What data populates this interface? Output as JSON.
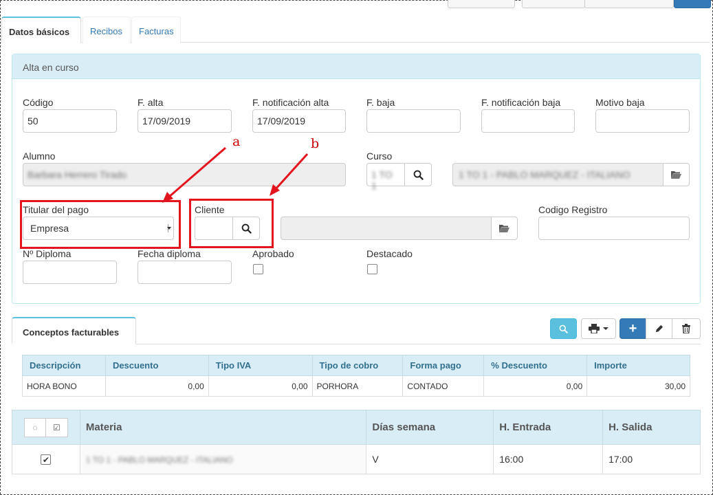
{
  "tabs": [
    {
      "label": "Datos básicos",
      "active": true
    },
    {
      "label": "Recibos",
      "active": false
    },
    {
      "label": "Facturas",
      "active": false
    }
  ],
  "panel": {
    "title": "Alta en curso",
    "fields": {
      "codigo": {
        "label": "Código",
        "value": "50"
      },
      "f_alta": {
        "label": "F. alta",
        "value": "17/09/2019"
      },
      "f_notif_alta": {
        "label": "F. notificación alta",
        "value": "17/09/2019"
      },
      "f_baja": {
        "label": "F. baja",
        "value": ""
      },
      "f_notif_baja": {
        "label": "F. notificación baja",
        "value": ""
      },
      "motivo_baja": {
        "label": "Motivo baja",
        "value": ""
      },
      "alumno": {
        "label": "Alumno",
        "value": "Barbara Herrero Tirado"
      },
      "curso": {
        "label": "Curso",
        "code": "1 TO 1",
        "name": "1 TO 1 - PABLO MARQUEZ - ITALIANO"
      },
      "titular": {
        "label": "Titular del pago",
        "value": "Empresa"
      },
      "cliente": {
        "label": "Cliente",
        "value": ""
      },
      "codigo_registro": {
        "label": "Codigo Registro",
        "value": ""
      },
      "n_diploma": {
        "label": "Nº Diploma",
        "value": ""
      },
      "fecha_diploma": {
        "label": "Fecha diploma",
        "value": ""
      },
      "aprobado": {
        "label": "Aprobado",
        "checked": false
      },
      "destacado": {
        "label": "Destacado",
        "checked": false
      }
    }
  },
  "annotations": {
    "a": "a",
    "b": "b",
    "color": "#e4141e"
  },
  "conceptos": {
    "tab_label": "Conceptos facturables",
    "columns": [
      "Descripción",
      "Descuento",
      "Tipo IVA",
      "Tipo de cobro",
      "Forma pago",
      "% Descuento",
      "Importe"
    ],
    "rows": [
      [
        "HORA BONO",
        "0,00",
        "0,00",
        "PORHORA",
        "CONTADO",
        "0,00",
        "30,00"
      ]
    ]
  },
  "horario": {
    "columns": [
      "Materia",
      "Días semana",
      "H. Entrada",
      "H. Salida"
    ],
    "rows": [
      {
        "checked": true,
        "materia": "1 TO 1 - PABLO MARQUEZ - ITALIANO",
        "dias": "V",
        "entrada": "16:00",
        "salida": "17:00"
      }
    ]
  },
  "icons": {
    "search": "search-icon",
    "folder": "folder-open-icon",
    "print": "print-icon",
    "add": "plus-icon",
    "edit": "pencil-icon",
    "delete": "trash-icon",
    "caret": "caret-down-icon"
  },
  "colors": {
    "info_bg": "#d9edf7",
    "info_btn": "#5bc0de",
    "primary": "#337ab7",
    "link": "#337ab7"
  }
}
